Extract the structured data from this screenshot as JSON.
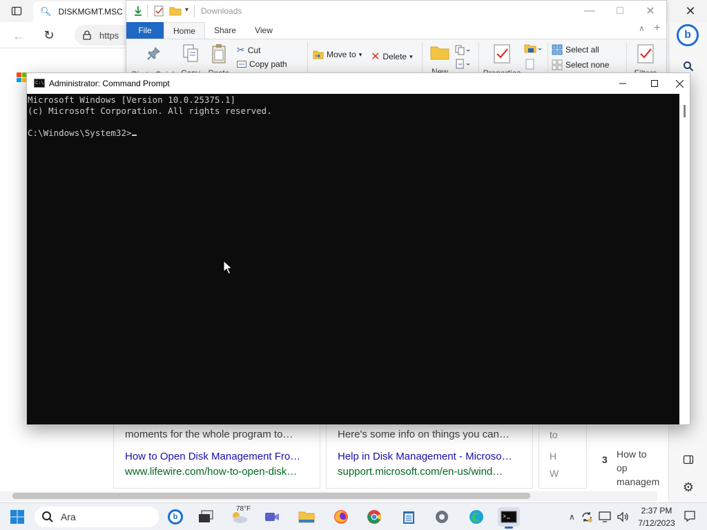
{
  "browser": {
    "tab_title": "DISKMGMT.MSC",
    "url_prefix": "https",
    "copilot_label": "b",
    "results": [
      {
        "snippet": "moments for the whole program to…",
        "title": "How to Open Disk Management Fro…",
        "url": "www.lifewire.com/how-to-open-disk…"
      },
      {
        "snippet": "Here's some info on things you can…",
        "title": "Help in Disk Management - Microso…",
        "url": "support.microsoft.com/en-us/wind…"
      }
    ],
    "side_fragments": [
      "to",
      "H",
      "W"
    ],
    "side_rank_number": "3",
    "side_rank_text": "How to op management"
  },
  "explorer": {
    "title": "Downloads",
    "tabs": [
      "File",
      "Home",
      "Share",
      "View"
    ],
    "ribbon": {
      "pin": "Pin to Quick",
      "copy": "Copy",
      "paste": "Paste",
      "cut": "Cut",
      "copy_path": "Copy path",
      "move_to": "Move to",
      "delete": "Delete",
      "new": "New",
      "properties": "Properties",
      "select_all": "Select all",
      "select_none": "Select none",
      "filters": "Filters"
    }
  },
  "cmd": {
    "title": "Administrator: Command Prompt",
    "icon_text": "C:\\",
    "lines": [
      "Microsoft Windows [Version 10.0.25375.1]",
      "(c) Microsoft Corporation. All rights reserved."
    ],
    "prompt": "C:\\Windows\\System32>"
  },
  "taskbar": {
    "search_label": "Ara",
    "weather_temp": "78°F",
    "time": "2:37 PM",
    "date": "7/12/2023"
  },
  "colors": {
    "accent": "#1f68c3",
    "console_bg": "#0c0c0c",
    "console_fg": "#cccccc",
    "link": "#1a0dab",
    "cite": "#006621"
  }
}
